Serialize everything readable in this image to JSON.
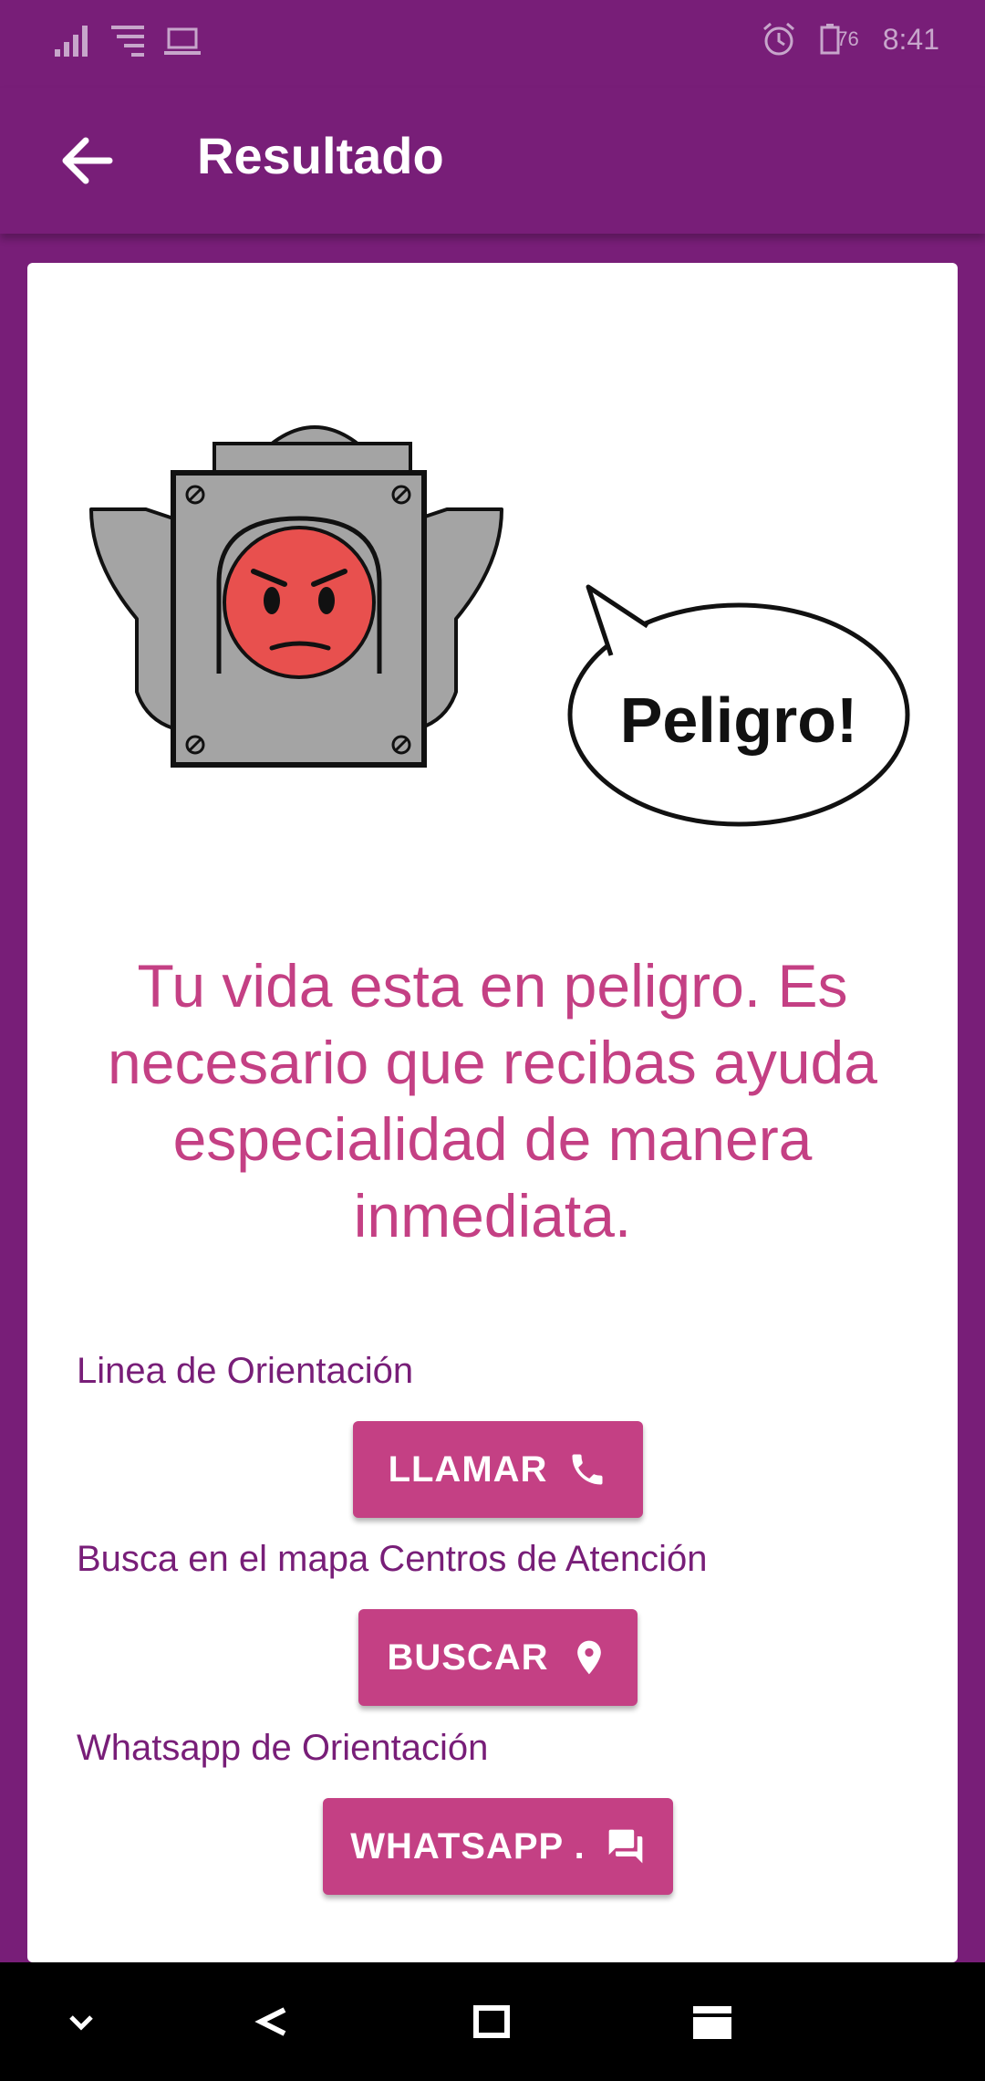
{
  "status_bar": {
    "time": "8:41",
    "battery_level": "76",
    "icons": [
      "signal-icon",
      "wifi-icon",
      "laptop-icon",
      "alarm-icon",
      "battery-icon"
    ]
  },
  "app_bar": {
    "title": "Resultado",
    "back_icon": "arrow-back-icon"
  },
  "illustration": {
    "speech_text": "Peligro!",
    "face_color": "#e8504e"
  },
  "message": "Tu vida esta en peligro. Es necesario que recibas ayuda especialidad de manera inmediata.",
  "sections": [
    {
      "label": "Linea de Orientación",
      "button_label": "LLAMAR",
      "button_icon": "phone-icon"
    },
    {
      "label": "Busca en el mapa Centros de Atención",
      "button_label": "BUSCAR",
      "button_icon": "location-pin-icon"
    },
    {
      "label": "Whatsapp de Orientación",
      "button_label": "WHATSAPP .",
      "button_icon": "chat-icon"
    }
  ],
  "nav_bar": {
    "icons": [
      "chevron-down-icon",
      "back-icon",
      "home-icon",
      "recents-icon"
    ]
  },
  "colors": {
    "primary": "#781e78",
    "accent": "#c44084",
    "card": "#ffffff"
  }
}
